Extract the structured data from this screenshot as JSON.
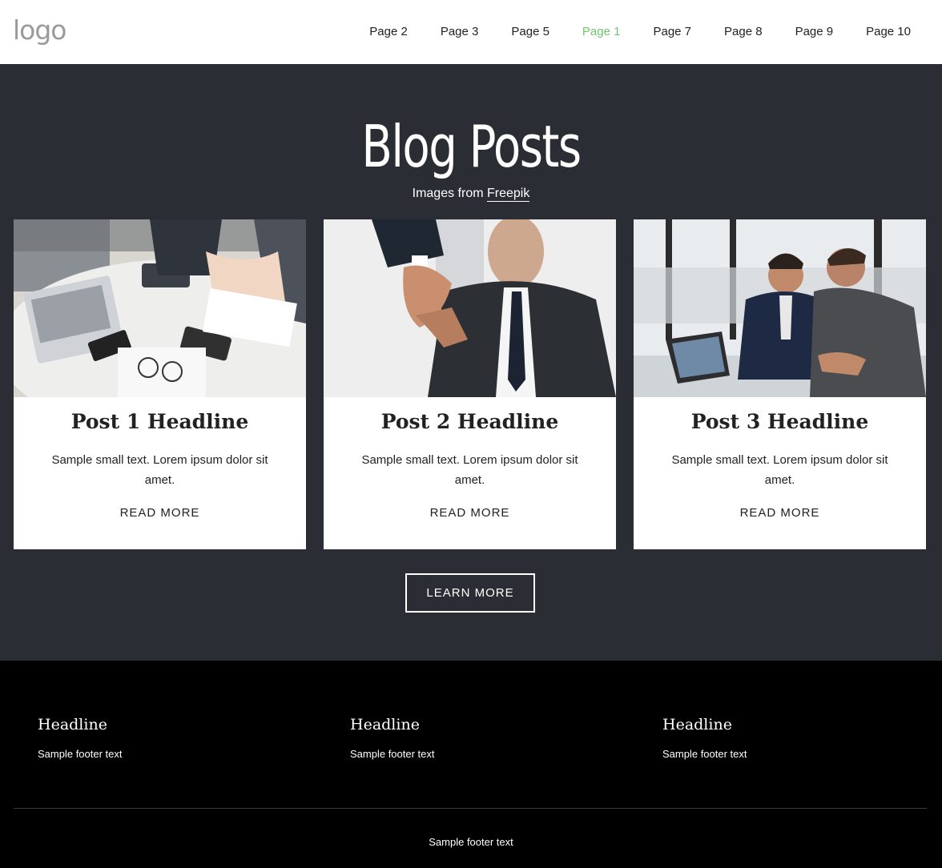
{
  "header": {
    "logo": "logo",
    "nav": [
      {
        "label": "Page 2",
        "active": false
      },
      {
        "label": "Page 3",
        "active": false
      },
      {
        "label": "Page 5",
        "active": false
      },
      {
        "label": "Page 1",
        "active": true
      },
      {
        "label": "Page 7",
        "active": false
      },
      {
        "label": "Page 8",
        "active": false
      },
      {
        "label": "Page 9",
        "active": false
      },
      {
        "label": "Page 10",
        "active": false
      }
    ]
  },
  "blog": {
    "title": "Blog Posts",
    "subtitle_prefix": "Images from",
    "subtitle_link": "Freepik",
    "posts": [
      {
        "headline": "Post 1 Headline",
        "text": "Sample small text. Lorem ipsum dolor sit amet.",
        "link": "READ MORE",
        "image": "business-meeting-table-photo"
      },
      {
        "headline": "Post 2 Headline",
        "text": "Sample small text. Lorem ipsum dolor sit amet.",
        "link": "READ MORE",
        "image": "handshake-photo"
      },
      {
        "headline": "Post 3 Headline",
        "text": "Sample small text. Lorem ipsum dolor sit amet.",
        "link": "READ MORE",
        "image": "two-businessmen-laptop-photo"
      }
    ],
    "button": "LEARN MORE"
  },
  "footer": {
    "columns": [
      {
        "headline": "Headline",
        "text": "Sample footer text"
      },
      {
        "headline": "Headline",
        "text": "Sample footer text"
      },
      {
        "headline": "Headline",
        "text": "Sample footer text"
      }
    ],
    "bottom_text": "Sample footer text"
  },
  "colors": {
    "accent": "#6fc46f",
    "section_bg": "#2a2d34",
    "footer_bg": "#000000"
  }
}
